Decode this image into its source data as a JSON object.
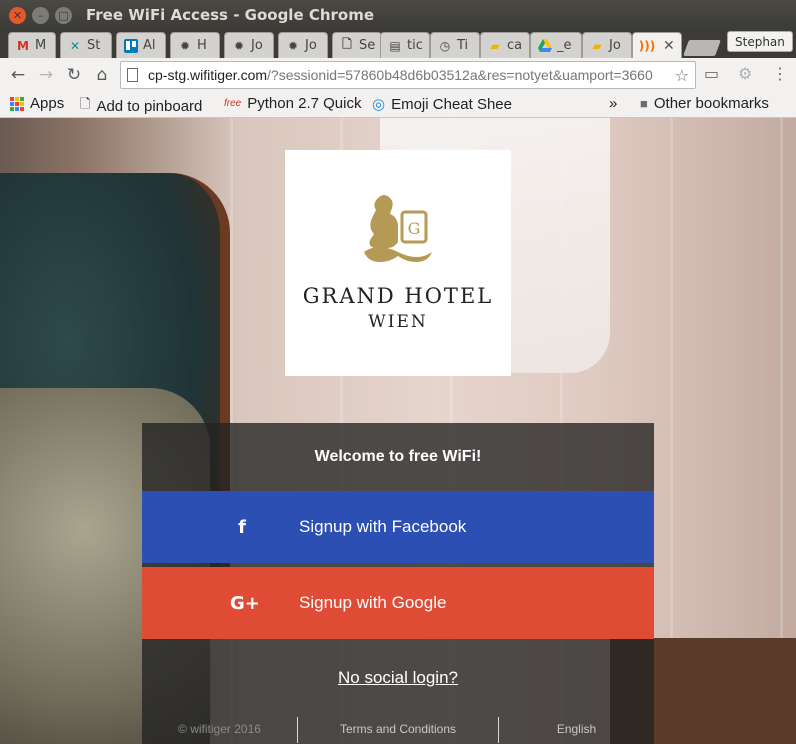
{
  "window": {
    "title": "Free WiFi Access - Google Chrome"
  },
  "tabs": [
    {
      "label": "M",
      "icon": "gmail-icon",
      "color": "#d93025"
    },
    {
      "label": "St",
      "icon": "xing-icon",
      "color": "#0f8c8e"
    },
    {
      "label": "Al",
      "icon": "trello-icon",
      "color": "#0079bf"
    },
    {
      "label": "H",
      "icon": "gear-puzzle-icon",
      "color": "#333333"
    },
    {
      "label": "Jo",
      "icon": "gear-puzzle-icon",
      "color": "#333333"
    },
    {
      "label": "Jo",
      "icon": "gear-puzzle-icon",
      "color": "#333333"
    },
    {
      "label": "Se",
      "icon": "document-icon",
      "color": "#555555"
    },
    {
      "label": "tic",
      "icon": "image-icon",
      "color": "#555555"
    },
    {
      "label": "Ti",
      "icon": "timer-icon",
      "color": "#333333"
    },
    {
      "label": "ca",
      "icon": "note-icon",
      "color": "#f0b400"
    },
    {
      "label": "_e",
      "icon": "drive-icon",
      "color": "#1fa463"
    },
    {
      "label": "Jo",
      "icon": "note-icon",
      "color": "#f0b400"
    },
    {
      "label": "",
      "icon": "wifi-icon",
      "color": "#ff6d00",
      "active": true
    }
  ],
  "profile": "Stephan",
  "url": {
    "host": "cp-stg.wifitiger.com",
    "path": "/?sessionid=57860b48d6b03512a&res=notyet&uamport=3660"
  },
  "bookmarks": [
    {
      "label": "Apps",
      "icon": "apps-icon"
    },
    {
      "label": "Add to pinboard",
      "icon": "page-icon"
    },
    {
      "label": "Python 2.7 Quick",
      "icon": "free-icon"
    },
    {
      "label": "Emoji Cheat Shee",
      "icon": "swirl-icon"
    },
    {
      "label": "»",
      "icon": ""
    },
    {
      "label": "Other bookmarks",
      "icon": "folder-icon"
    }
  ],
  "logo": {
    "name": "GRAND HOTEL",
    "city": "WIEN"
  },
  "login": {
    "welcome": "Welcome to free WiFi!",
    "facebook": "Signup with Facebook",
    "facebook_icon": "f",
    "google": "Signup with Google",
    "google_icon": "G+",
    "no_social": "No social login?",
    "footer": {
      "copyright": "© wifitiger 2016",
      "terms": "Terms and Conditions",
      "language": "English"
    }
  },
  "colors": {
    "facebook": "#2b4fb2",
    "google": "#e04b36",
    "gold": "#b59a55"
  }
}
